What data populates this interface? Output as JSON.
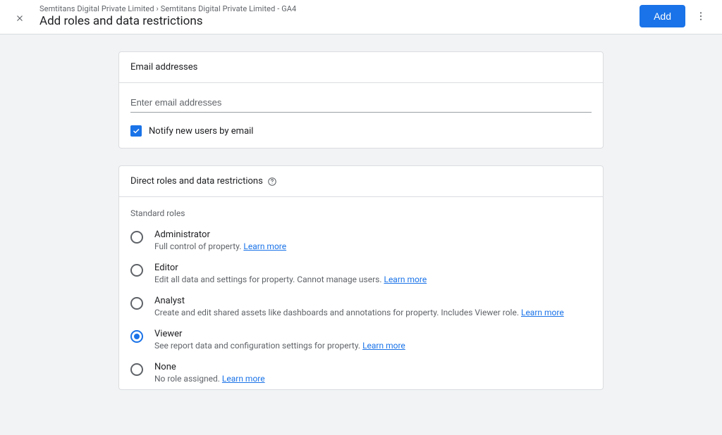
{
  "header": {
    "breadcrumb": "Semtitans Digital Private Limited › Semtitans Digital Private Limited - GA4",
    "title": "Add roles and data restrictions",
    "add_button": "Add"
  },
  "email_card": {
    "header": "Email addresses",
    "placeholder": "Enter email addresses",
    "notify_label": "Notify new users by email",
    "notify_checked": true
  },
  "roles_card": {
    "header": "Direct roles and data restrictions",
    "section_label": "Standard roles",
    "learn_more": "Learn more",
    "roles": [
      {
        "id": "administrator",
        "title": "Administrator",
        "desc": "Full control of property.",
        "selected": false
      },
      {
        "id": "editor",
        "title": "Editor",
        "desc": "Edit all data and settings for property. Cannot manage users.",
        "selected": false
      },
      {
        "id": "analyst",
        "title": "Analyst",
        "desc": "Create and edit shared assets like dashboards and annotations for property. Includes Viewer role.",
        "selected": false
      },
      {
        "id": "viewer",
        "title": "Viewer",
        "desc": "See report data and configuration settings for property.",
        "selected": true
      },
      {
        "id": "none",
        "title": "None",
        "desc": "No role assigned.",
        "selected": false
      }
    ]
  }
}
